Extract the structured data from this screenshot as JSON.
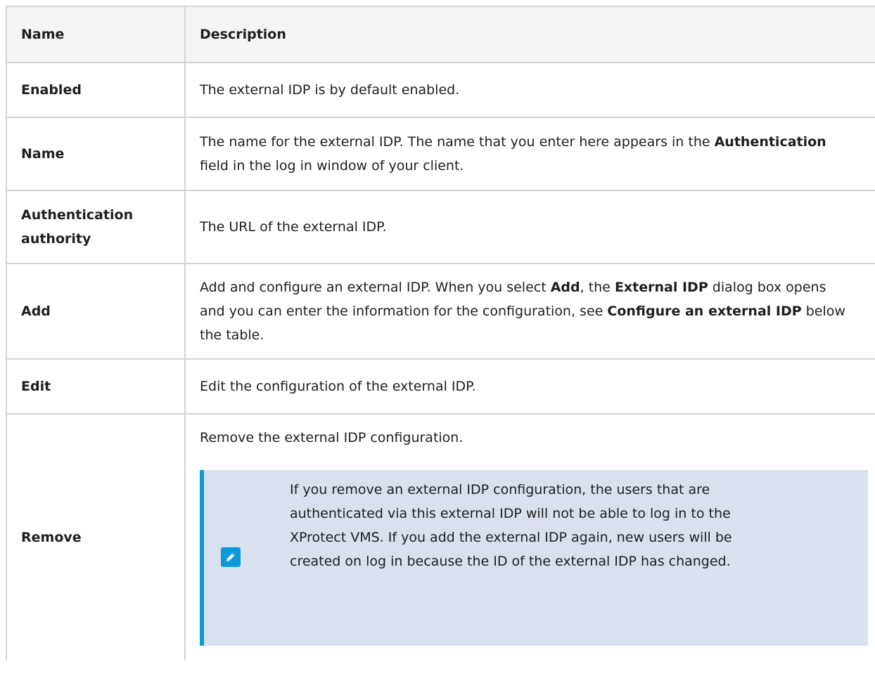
{
  "table": {
    "header": {
      "name": "Name",
      "description": "Description"
    },
    "rows": [
      {
        "name": "Enabled",
        "description": [
          {
            "text": "The external IDP is by default enabled.",
            "bold": false
          }
        ]
      },
      {
        "name": "Name",
        "description": [
          {
            "text": "The name for the external IDP. The name that you enter here appears in the ",
            "bold": false
          },
          {
            "text": "Authentication",
            "bold": true
          },
          {
            "text": " field in the log in window of your client.",
            "bold": false
          }
        ]
      },
      {
        "name": "Authentication authority",
        "description": [
          {
            "text": "The URL of the external IDP.",
            "bold": false
          }
        ]
      },
      {
        "name": "Add",
        "description": [
          {
            "text": "Add and configure an external IDP. When you select ",
            "bold": false
          },
          {
            "text": "Add",
            "bold": true
          },
          {
            "text": ", the ",
            "bold": false
          },
          {
            "text": "External IDP",
            "bold": true
          },
          {
            "text": " dialog box opens and you can enter the information for the configuration, see ",
            "bold": false
          },
          {
            "text": "Configure an external IDP",
            "bold": true
          },
          {
            "text": " below the table.",
            "bold": false
          }
        ]
      },
      {
        "name": "Edit",
        "description": [
          {
            "text": "Edit the configuration of the external IDP.",
            "bold": false
          }
        ]
      },
      {
        "name": "Remove",
        "description": [
          {
            "text": "Remove the external IDP configuration.",
            "bold": false
          }
        ],
        "note": {
          "icon": "pencil-icon",
          "text": "If you remove an external IDP configuration, the users that are authenticated via this external IDP will not be able to log in to the XProtect VMS. If you add the external IDP again, new users will be created on log in because the ID of the external IDP has changed."
        }
      }
    ]
  },
  "colors": {
    "border": "#d4d4d4",
    "header_bg": "#f5f5f5",
    "note_bg": "#d9e1ef",
    "note_accent": "#0a9ad8"
  }
}
